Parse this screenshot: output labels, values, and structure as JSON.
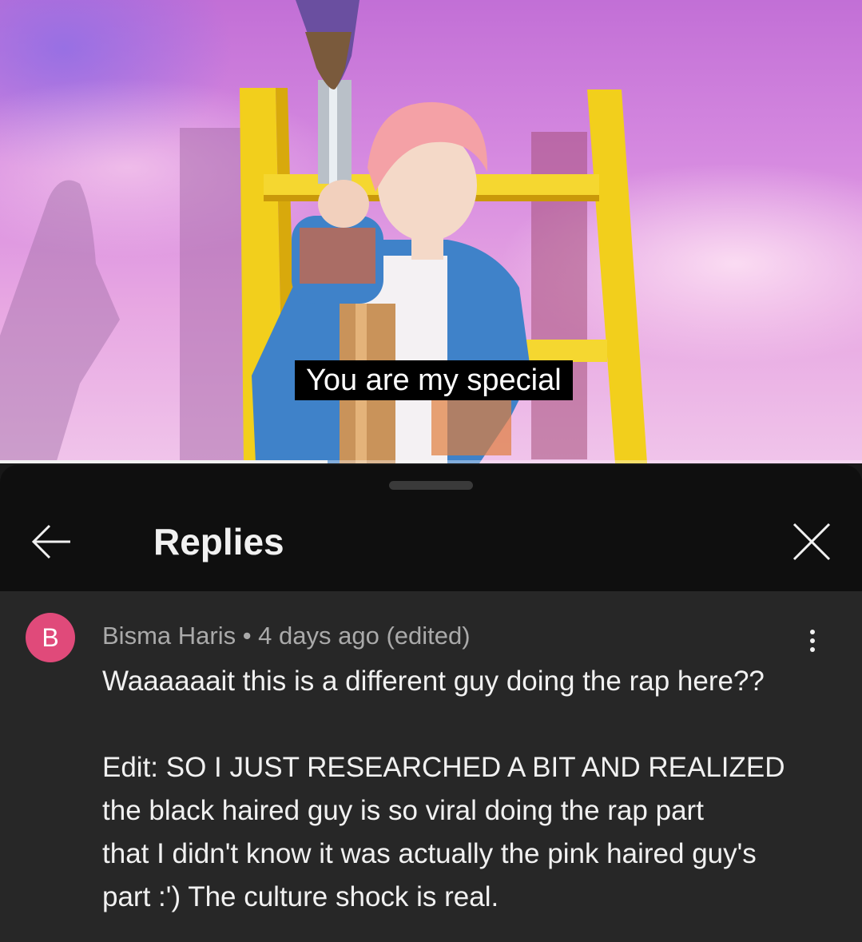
{
  "video": {
    "caption": "You are my special",
    "progress": 0.38
  },
  "sheet": {
    "title": "Replies",
    "icons": {
      "back": "arrow-left-icon",
      "close": "close-icon",
      "more": "more-vert-icon"
    }
  },
  "comment": {
    "avatar_initial": "B",
    "avatar_color": "#e04a7a",
    "meta": "Bisma Haris • 4 days ago (edited)",
    "lines": [
      "Waaaaaait this is a different guy doing the rap here??",
      "",
      "Edit: SO I JUST RESEARCHED A BIT AND REALIZED",
      "the black haired guy is so viral doing the rap part",
      "that I didn't know it was actually the pink haired guy's",
      "part :') The culture shock is real."
    ]
  }
}
